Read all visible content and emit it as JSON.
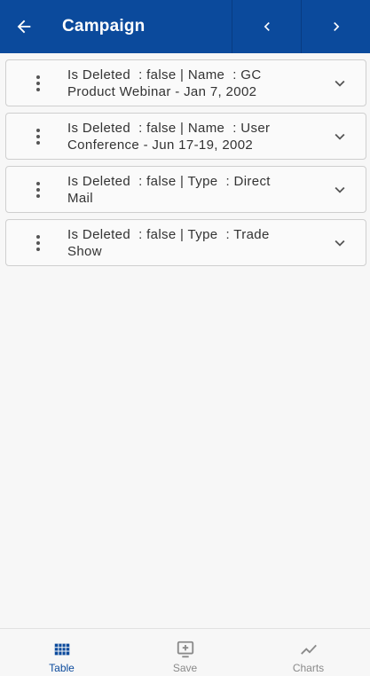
{
  "appbar": {
    "title": "Campaign",
    "back_icon": "arrow-left-icon",
    "prev_icon": "chevron-left-icon",
    "next_icon": "chevron-right-icon",
    "background": "#0b4a9c"
  },
  "records": [
    {
      "text": "Is Deleted  : false | Name  : GC\nProduct Webinar - Jan 7, 2002"
    },
    {
      "text": "Is Deleted  : false | Name  : User\nConference - Jun 17-19, 2002"
    },
    {
      "text": "Is Deleted  : false | Type  : Direct\nMail"
    },
    {
      "text": "Is Deleted  : false | Type  : Trade\nShow"
    }
  ],
  "bottom_nav": {
    "tabs": [
      {
        "label": "Table",
        "icon": "table-grid-icon",
        "active": true
      },
      {
        "label": "Save",
        "icon": "add-box-icon",
        "active": false
      },
      {
        "label": "Charts",
        "icon": "line-chart-icon",
        "active": false
      }
    ],
    "active_color": "#0b4a9c",
    "inactive_color": "#8a8a8a"
  }
}
